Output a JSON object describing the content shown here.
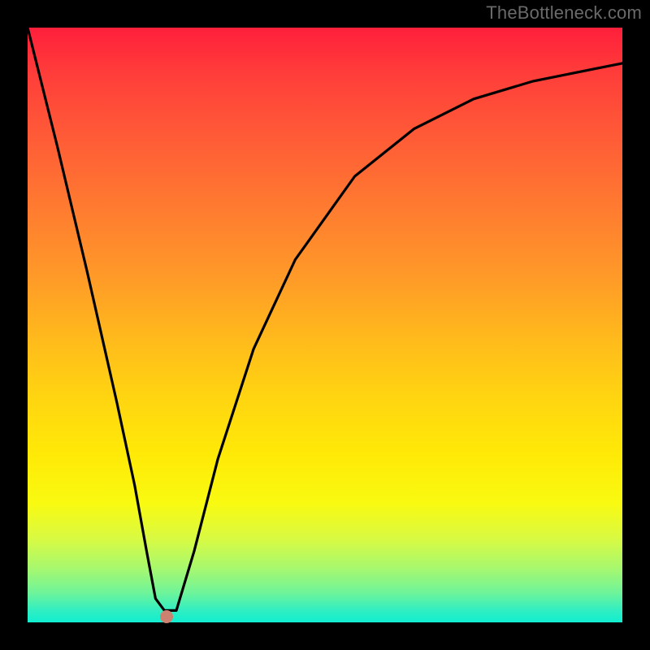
{
  "watermark": "TheBottleneck.com",
  "colors": {
    "frame_bg": "#000000",
    "marker": "#cd8170",
    "curve": "#000000",
    "gradient_stops": [
      "#ff1f3b",
      "#ff3e3a",
      "#ff5a37",
      "#ff7a30",
      "#ff9a28",
      "#ffb91c",
      "#ffd411",
      "#ffea07",
      "#f9fa11",
      "#d8fa43",
      "#a6f86f",
      "#6ff49a",
      "#30eec2",
      "#10eed0"
    ]
  },
  "chart_data": {
    "type": "line",
    "title": "",
    "xlabel": "",
    "ylabel": "",
    "xlim": [
      0,
      1
    ],
    "ylim": [
      0,
      1
    ],
    "note": "Axes are unlabeled in the source image; values are normalized 0–1 estimates from pixel positions. y=1 is the top (red), y=0 is the bottom (green). x=0 is left edge, x=1 is right edge.",
    "series": [
      {
        "name": "curve",
        "x": [
          0.0,
          0.05,
          0.1,
          0.15,
          0.18,
          0.2,
          0.215,
          0.23,
          0.25,
          0.28,
          0.32,
          0.38,
          0.45,
          0.55,
          0.65,
          0.75,
          0.85,
          0.95,
          1.0
        ],
        "y": [
          1.0,
          0.8,
          0.59,
          0.37,
          0.23,
          0.12,
          0.04,
          0.02,
          0.02,
          0.12,
          0.275,
          0.46,
          0.61,
          0.75,
          0.83,
          0.88,
          0.91,
          0.93,
          0.94
        ]
      }
    ],
    "marker": {
      "x": 0.234,
      "y": 0.01
    }
  }
}
